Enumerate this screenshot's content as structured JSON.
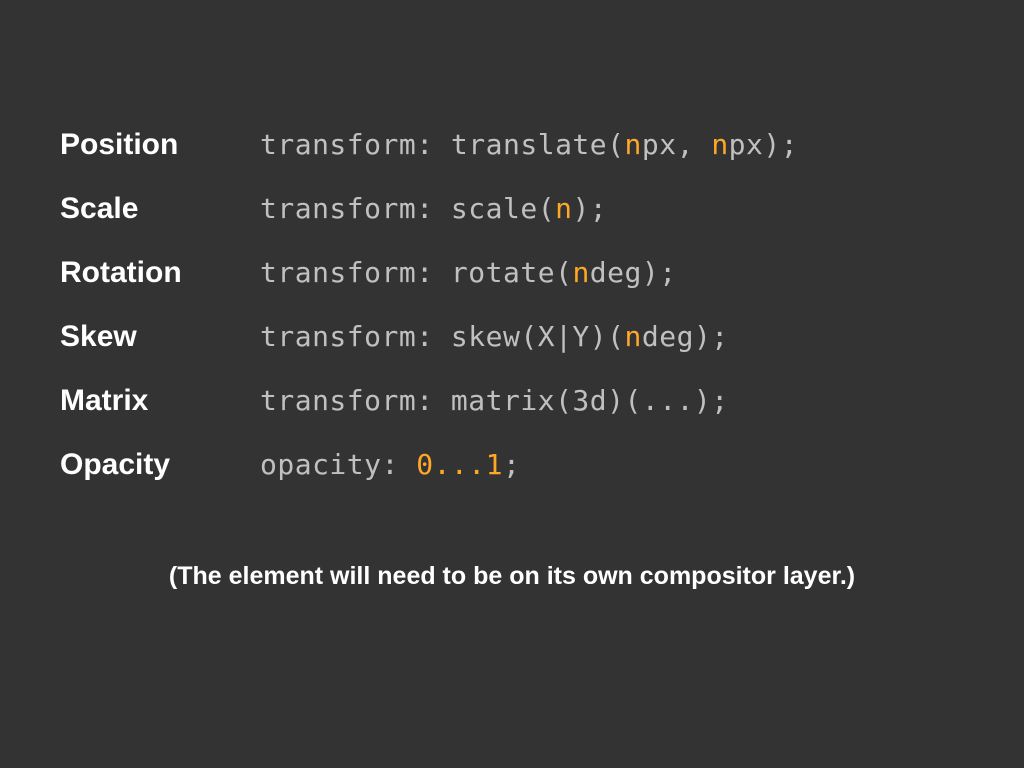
{
  "rows": [
    {
      "label": "Position",
      "code_parts": [
        "transform: translate(",
        "n",
        "px, ",
        "n",
        "px);"
      ],
      "accent_indices": [
        1,
        3
      ]
    },
    {
      "label": "Scale",
      "code_parts": [
        "transform: scale(",
        "n",
        ");"
      ],
      "accent_indices": [
        1
      ]
    },
    {
      "label": "Rotation",
      "code_parts": [
        "transform: rotate(",
        "n",
        "deg);"
      ],
      "accent_indices": [
        1
      ]
    },
    {
      "label": "Skew",
      "code_parts": [
        "transform: skew(X|Y)(",
        "n",
        "deg);"
      ],
      "accent_indices": [
        1
      ]
    },
    {
      "label": "Matrix",
      "code_parts": [
        "transform: matrix(3d)(...);"
      ],
      "accent_indices": []
    },
    {
      "label": "Opacity",
      "code_parts": [
        "opacity: ",
        "0...1",
        ";"
      ],
      "accent_indices": [
        1
      ]
    }
  ],
  "footer": "(The element will need to be on its own compositor layer.)"
}
